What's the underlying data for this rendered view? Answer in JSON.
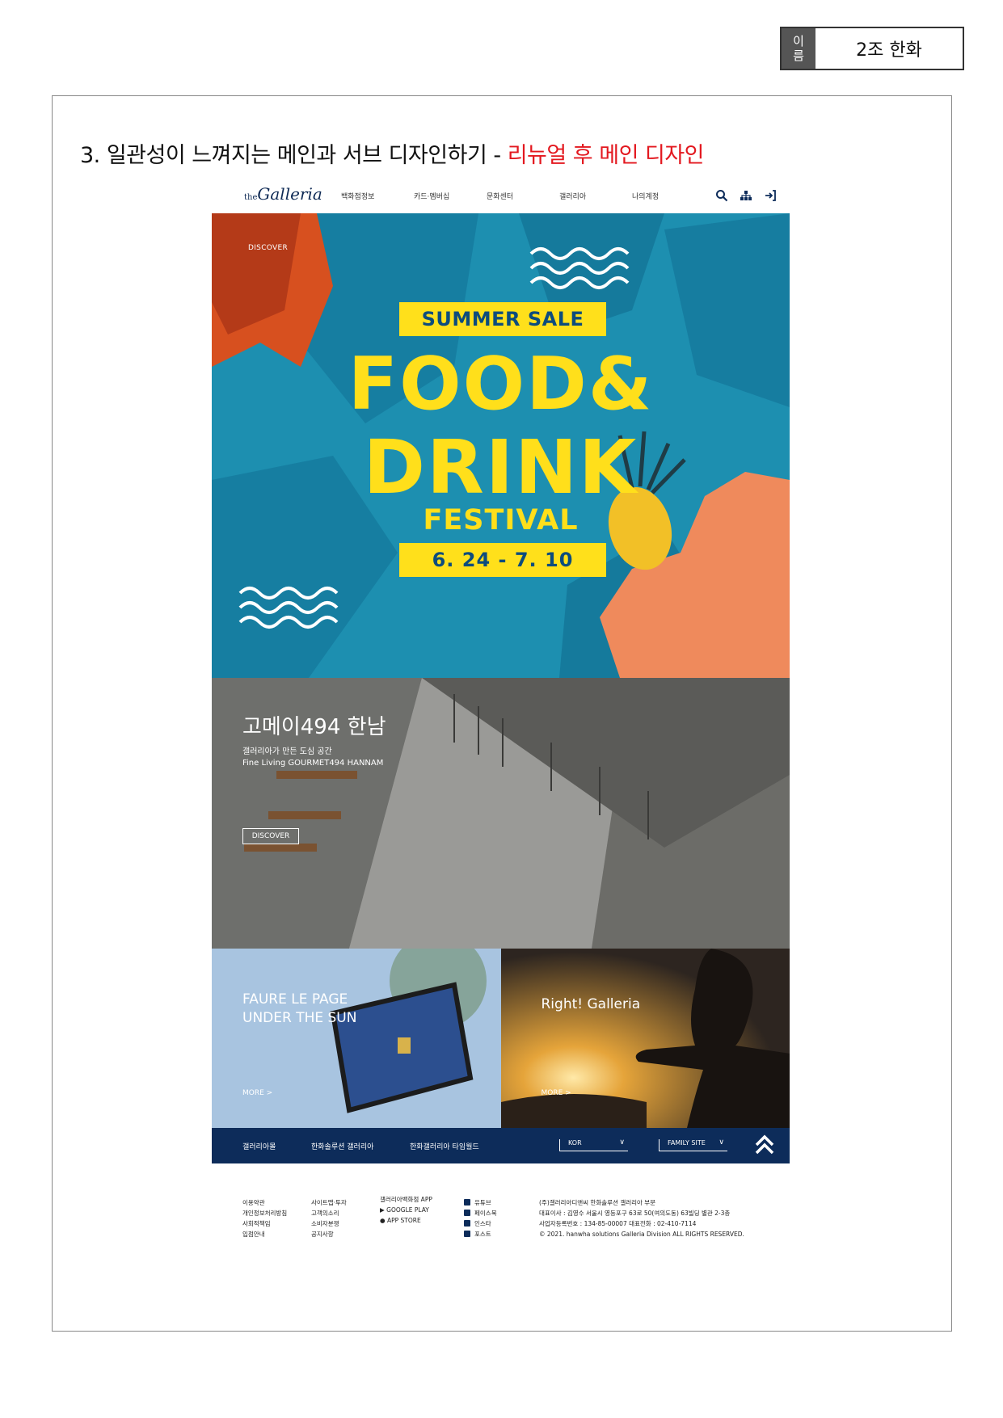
{
  "namebox": {
    "label": "이\n름",
    "value": "2조 한화"
  },
  "heading": {
    "main": "3. 일관성이 느껴지는 메인과 서브 디자인하기 - ",
    "highlight": "리뉴얼 후 메인 디자인"
  },
  "nav": {
    "logo": "Galleria",
    "logo_prefix": "the",
    "items": [
      "백화점정보",
      "카드·멤버십",
      "문화센터",
      "갤러리아",
      "나의계정"
    ],
    "icons": [
      "search-icon",
      "sitemap-icon",
      "login-icon"
    ]
  },
  "hero": {
    "discover": "DISCOVER",
    "sale": "SUMMER SALE",
    "line1": "FOOD&",
    "line2": "DRINK",
    "line3": "FESTIVAL",
    "dates": "6. 24 - 7. 10",
    "colors": {
      "bg": "#1d8fb0",
      "yellow": "#ffe01b",
      "orange": "#ef8a5c"
    }
  },
  "gourmet": {
    "title": "고메이494 한남",
    "subtitle": "갤러리아가 만든 도심 공간",
    "tags": "Fine Living    GOURMET494 HANNAM",
    "button": "DISCOVER"
  },
  "cards": [
    {
      "title1": "FAURE LE PAGE",
      "title2": "UNDER THE SUN",
      "more": "MORE >"
    },
    {
      "title1": "Right! Galleria",
      "title2": "",
      "more": "MORE >"
    }
  ],
  "footer_bar": {
    "links": [
      "갤러리아몰",
      "한화솔루션 갤러리아",
      "한화갤러리아 타임월드"
    ],
    "lang": "KOR",
    "family": "FAMILY SITE"
  },
  "footer": {
    "col1": [
      "이용약관",
      "개인정보처리방침",
      "사회적책임",
      "입점안내"
    ],
    "col2": [
      "사이트맵·투자",
      "고객의소리",
      "소비자분쟁",
      "공지사항"
    ],
    "col3_title": "갤러리아백화점 APP",
    "col3": [
      "GOOGLE PLAY",
      "APP STORE"
    ],
    "col4": [
      "유튜브",
      "페이스북",
      "인스타",
      "포스트"
    ],
    "col5": [
      "(주)갤러리아디앤씨    한화솔루션 갤러리아 부문",
      "대표이사 : 김영수    서울시 영등포구 63로 50(여의도동) 63빌딩 별관 2-3층",
      "사업자등록번호 : 134-85-00007    대표전화 : 02-410-7114",
      "© 2021. hanwha solutions Galleria Division ALL RIGHTS RESERVED."
    ]
  }
}
